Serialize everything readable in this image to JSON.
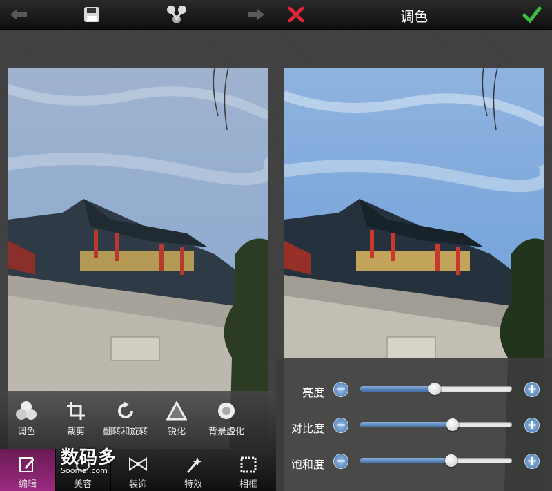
{
  "left": {
    "tools": [
      {
        "label": "调色",
        "icon": "color-adjust-icon"
      },
      {
        "label": "裁剪",
        "icon": "crop-icon"
      },
      {
        "label": "翻转和旋转",
        "icon": "rotate-icon"
      },
      {
        "label": "锐化",
        "icon": "sharpen-icon"
      },
      {
        "label": "背景虚化",
        "icon": "blur-icon"
      }
    ],
    "tabs": [
      {
        "label": "编辑",
        "icon": "edit-icon",
        "active": true
      },
      {
        "label": "美容",
        "icon": "beauty-icon"
      },
      {
        "label": "装饰",
        "icon": "bow-icon"
      },
      {
        "label": "特效",
        "icon": "magic-wand-icon"
      },
      {
        "label": "相框",
        "icon": "frame-icon"
      }
    ],
    "watermark": {
      "main": "数码多",
      "sub": "Soomal.com"
    }
  },
  "right": {
    "title": "调色",
    "sliders": [
      {
        "label": "亮度",
        "value": 0.49
      },
      {
        "label": "对比度",
        "value": 0.61
      },
      {
        "label": "饱和度",
        "value": 0.6
      }
    ]
  },
  "colors": {
    "accent": "#4f7fb8",
    "active_tab": "#8b2372",
    "cancel": "#e0263b",
    "confirm": "#3fbf3f"
  }
}
